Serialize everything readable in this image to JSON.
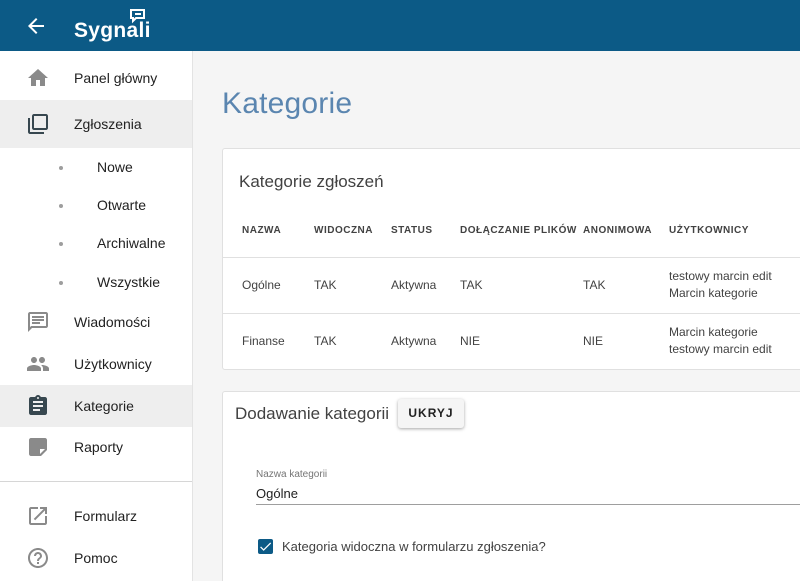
{
  "app": {
    "name": "Sygnali",
    "brand_color": "#0c5a86"
  },
  "sidebar": {
    "items": [
      {
        "label": "Panel główny",
        "icon": "home-icon"
      },
      {
        "label": "Zgłoszenia",
        "icon": "copy-icon",
        "children": [
          "Nowe",
          "Otwarte",
          "Archiwalne",
          "Wszystkie"
        ]
      },
      {
        "label": "Wiadomości",
        "icon": "message-icon"
      },
      {
        "label": "Użytkownicy",
        "icon": "people-icon"
      },
      {
        "label": "Kategorie",
        "icon": "clipboard-icon",
        "active": true
      },
      {
        "label": "Raporty",
        "icon": "note-icon"
      }
    ],
    "footer_items": [
      {
        "label": "Formularz",
        "icon": "open-in-new-icon"
      },
      {
        "label": "Pomoc",
        "icon": "help-icon"
      }
    ]
  },
  "page": {
    "title": "Kategorie"
  },
  "categories_card": {
    "title": "Kategorie zgłoszeń",
    "columns": [
      "Nazwa",
      "Widoczna",
      "Status",
      "Dołączanie plików",
      "Anonimowa",
      "Użytkownicy"
    ],
    "rows": [
      {
        "name": "Ogólne",
        "visible": "TAK",
        "status": "Aktywna",
        "files": "TAK",
        "anonymous": "TAK",
        "users": [
          "testowy marcin edit",
          "Marcin kategorie"
        ]
      },
      {
        "name": "Finanse",
        "visible": "TAK",
        "status": "Aktywna",
        "files": "NIE",
        "anonymous": "NIE",
        "users": [
          "Marcin kategorie",
          "testowy marcin edit"
        ]
      }
    ]
  },
  "add_card": {
    "title": "Dodawanie kategorii",
    "hide_button": "UKRYJ",
    "name_field_label": "Nazwa kategorii",
    "name_field_value": "Ogólne",
    "visible_checkbox_label": "Kategoria widoczna w formularzu zgłoszenia?",
    "visible_checked": true
  }
}
